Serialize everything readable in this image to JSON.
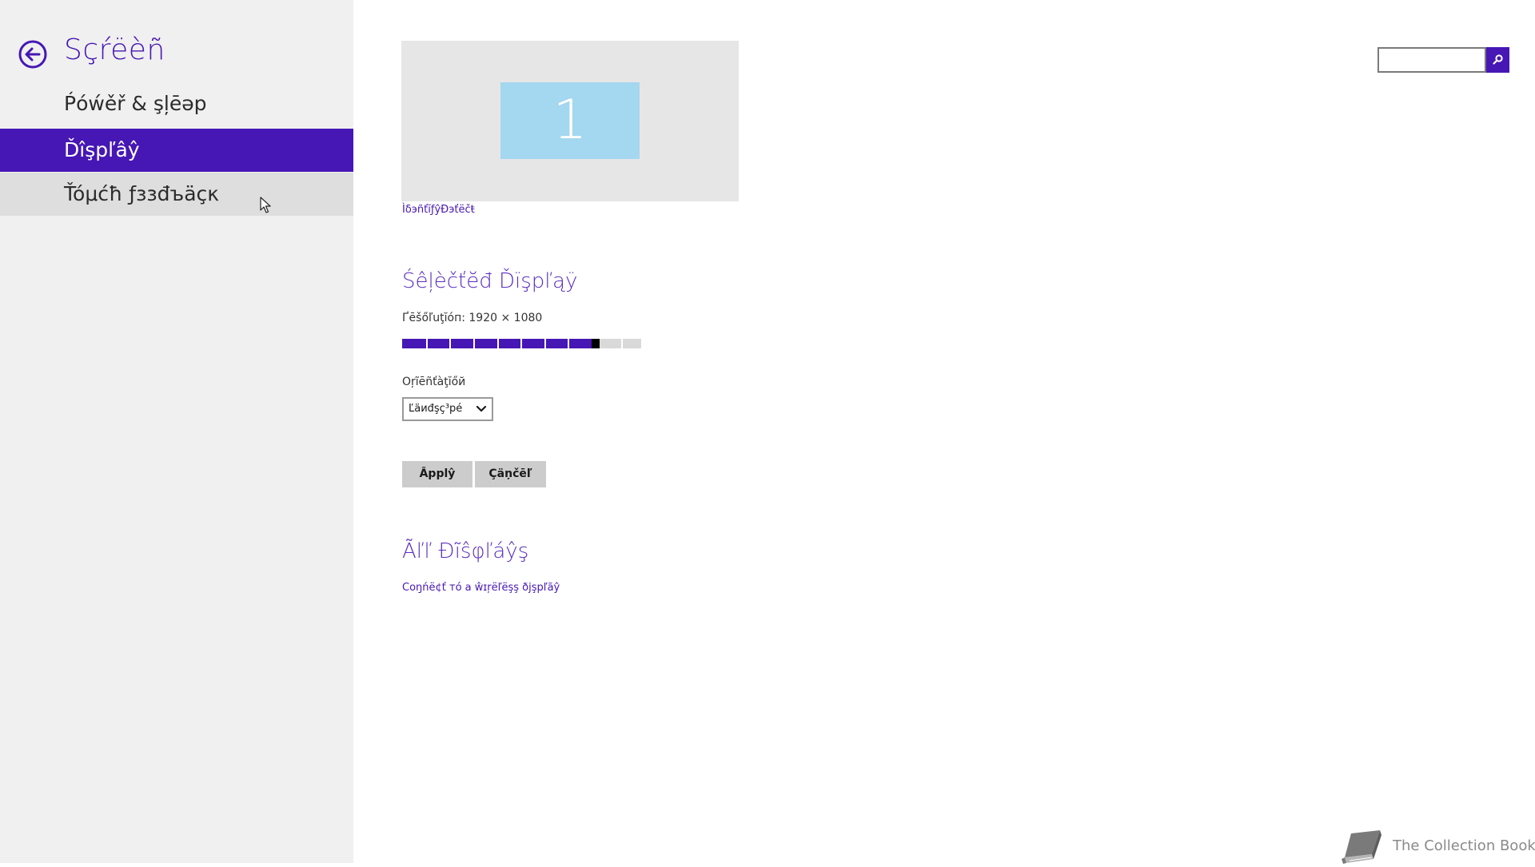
{
  "sidebar": {
    "title": "Sçŕëèñ",
    "items": [
      {
        "label": "Ṕóẃěř & şļēəp",
        "selected": false
      },
      {
        "label": "Ďîşpľâŷ",
        "selected": true
      },
      {
        "label": "Ťóμćħ ƒɜɜđъäçκ",
        "selected": false
      }
    ]
  },
  "main": {
    "monitor": {
      "number": "1"
    },
    "identify_link": "ÌδэñťĭƒŷĐэťёčŧ",
    "selected_display": {
      "title": "Śêļèčťĕđ Ďïşpľąÿ",
      "resolution_label": "Ґēšőľuţĭóп: 1920 × 1080",
      "resolution_slider": {
        "value_fraction": 0.82,
        "steps": 8
      },
      "orientation_label": "Оŗĩēñťàţĭőй",
      "orientation_value": "Ľäиđşç³pé"
    },
    "buttons": {
      "apply": "Ȃpplŷ",
      "cancel": "Çäņčēľ"
    },
    "all_displays": {
      "title": "Ãľľ Đĩŝφľáŷş",
      "wireless_link": "Coŋńё¢ť тό a ŵɪŗёľёşş ðјşpľãŷ"
    }
  },
  "search": {
    "value": ""
  },
  "watermark": {
    "text": "The Collection Book"
  },
  "colors": {
    "accent": "#4617b4",
    "sidebar_bg": "#f0f0f0",
    "hover_bg": "#dedede",
    "monitor_tile": "#a4d7f0"
  }
}
